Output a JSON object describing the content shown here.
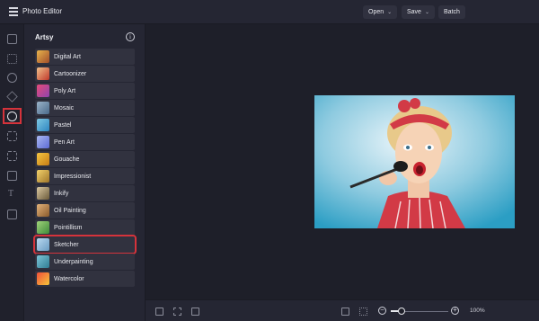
{
  "header": {
    "title": "Photo Editor",
    "open_label": "Open",
    "save_label": "Save",
    "batch_label": "Batch"
  },
  "panel": {
    "title": "Artsy",
    "info_glyph": "i",
    "effects": [
      {
        "label": "Digital Art"
      },
      {
        "label": "Cartoonizer"
      },
      {
        "label": "Poly Art"
      },
      {
        "label": "Mosaic"
      },
      {
        "label": "Pastel"
      },
      {
        "label": "Pen Art"
      },
      {
        "label": "Gouache"
      },
      {
        "label": "Impressionist"
      },
      {
        "label": "Inkify"
      },
      {
        "label": "Oil Painting"
      },
      {
        "label": "Pointillism"
      },
      {
        "label": "Sketcher"
      },
      {
        "label": "Underpainting"
      },
      {
        "label": "Watercolor"
      }
    ],
    "selected_effect": "Sketcher"
  },
  "toolbar_bottom": {
    "zoom_label": "100%",
    "zoom_minus": "−",
    "zoom_plus": "+"
  },
  "colors": {
    "background": "#1e1f29",
    "panel": "#252633",
    "item": "#31323f",
    "highlight": "#d5333b"
  }
}
